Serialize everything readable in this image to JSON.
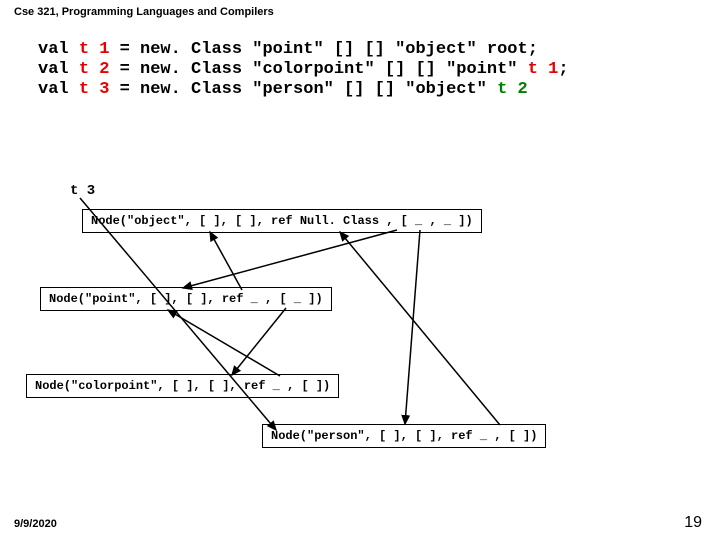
{
  "header": "Cse 321, Programming Languages and Compilers",
  "code": {
    "line1": {
      "pre": "val ",
      "var": "t 1",
      "post": " = new. Class \"point\" [] [] \"object\" root;"
    },
    "line2": {
      "pre": "val ",
      "var": "t 2",
      "post1": " = new. Class \"colorpoint\" [] [] \"point\" ",
      "tail": "t 1",
      "post2": ";"
    },
    "line3": {
      "pre": "val ",
      "var": "t 3",
      "post1": " = new. Class \"person\" [] [] \"object\" ",
      "tail": "t 2"
    }
  },
  "t3label": "t 3",
  "nodes": {
    "object": "Node(\"object\", [ ], [ ], ref Null. Class , [ _ , _ ])",
    "point": "Node(\"point\", [ ], [ ], ref _ , [ _ ])",
    "colorpoint": "Node(\"colorpoint\", [ ], [ ], ref _ , [ ])",
    "person": "Node(\"person\", [ ], [ ], ref _ , [ ])"
  },
  "footer": {
    "date": "9/9/2020",
    "page": "19"
  }
}
